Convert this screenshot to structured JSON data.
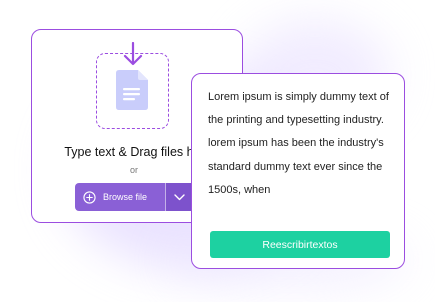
{
  "upload": {
    "title": "Type text & Drag files here",
    "or_label": "or",
    "browse_label": "Browse file",
    "icons": {
      "arrow": "download-arrow-icon",
      "document": "document-icon",
      "plus": "plus-circle-icon",
      "dropdown": "chevron-down-icon"
    }
  },
  "result": {
    "text": "Lorem ipsum is simply dummy text of the printing and typesetting industry. lorem ipsum has been the industry's standard dummy text ever since the 1500s, when",
    "button_label": "Reescribirtextos"
  },
  "colors": {
    "accent_border": "#9b4de0",
    "browse_button": "#8a60d6",
    "rewrite_button": "#1dd1a1",
    "document_icon": "#c9cdfb"
  }
}
